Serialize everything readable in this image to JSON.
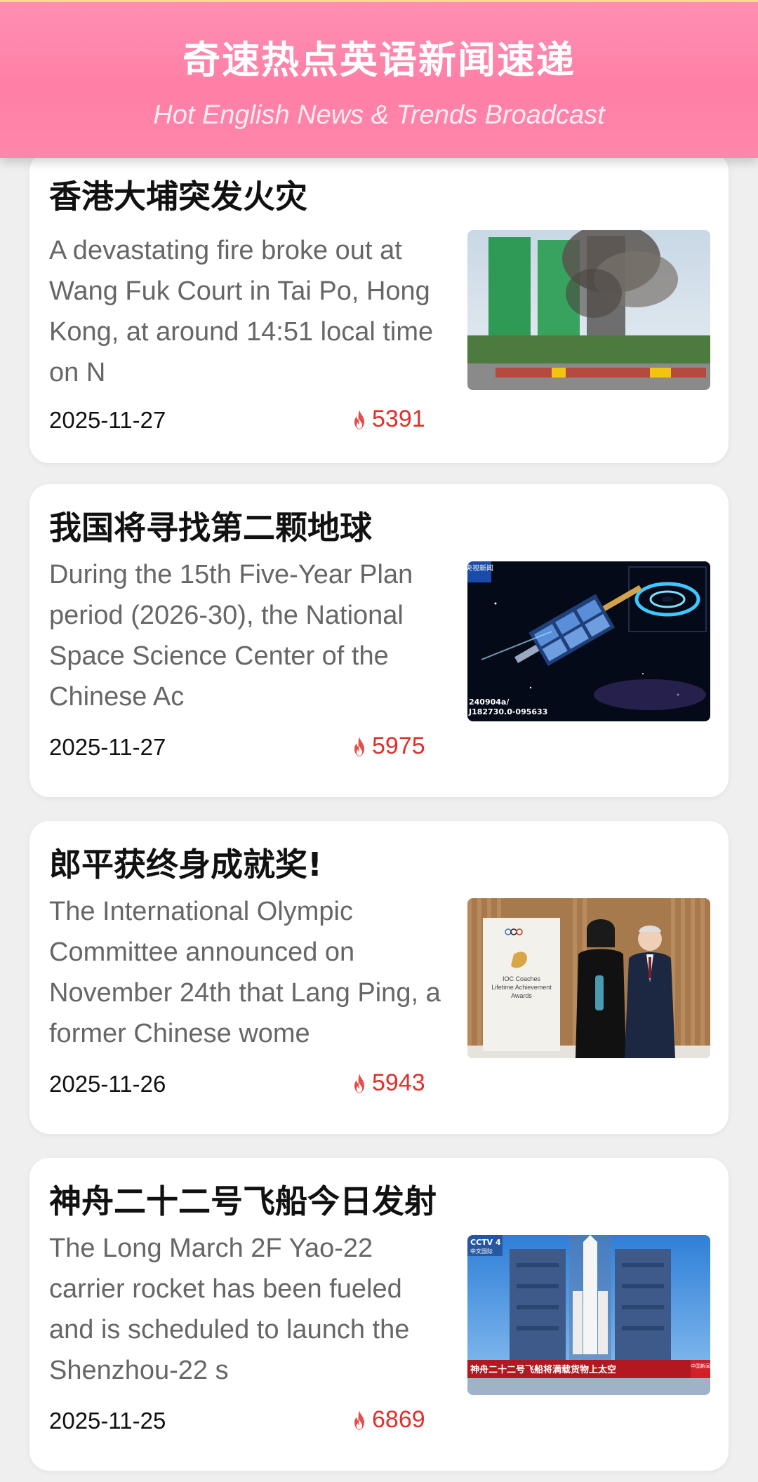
{
  "header": {
    "title": "奇速热点英语新闻速递",
    "subtitle": "Hot English News & Trends Broadcast"
  },
  "colors": {
    "header_gradient": "#ff8fb3",
    "hot_red": "#e0302c",
    "background": "#efefef"
  },
  "news": [
    {
      "title": "香港大埔突发火灾",
      "summary": "A devastating fire broke out at Wang Fuk Court in Tai Po, Hong Kong, at around 14:51 local time on N",
      "date": "2025-11-27",
      "hot": "5391",
      "icon": "flame-icon"
    },
    {
      "title": "我国将寻找第二颗地球",
      "summary": "During the 15th Five-Year Plan period (2026-30), the National Space Science Center of the Chinese Ac",
      "date": "2025-11-27",
      "hot": "5975",
      "icon": "flame-icon",
      "thumb_badge": "央视新闻",
      "thumb_caption_1": "240904a/",
      "thumb_caption_2": "J182730.0-095633"
    },
    {
      "title": "郎平获终身成就奖!",
      "summary": "The International Olympic Committee announced on November 24th that Lang Ping, a former Chinese wome",
      "date": "2025-11-26",
      "hot": "5943",
      "icon": "flame-icon",
      "thumb_sign_1": "IOC Coaches",
      "thumb_sign_2": "Lifetime Achievement",
      "thumb_sign_3": "Awards"
    },
    {
      "title": "神舟二十二号飞船今日发射",
      "summary": "The Long March 2F Yao-22 carrier rocket has been fueled and is scheduled to launch the Shenzhou-22 s",
      "date": "2025-11-25",
      "hot": "6869",
      "icon": "flame-icon",
      "thumb_badge": "CCTV 4",
      "thumb_badge_sub": "中文国际",
      "thumb_caption": "神舟二十二号飞船将满载货物上太空",
      "thumb_corner": "中国新闻"
    }
  ]
}
